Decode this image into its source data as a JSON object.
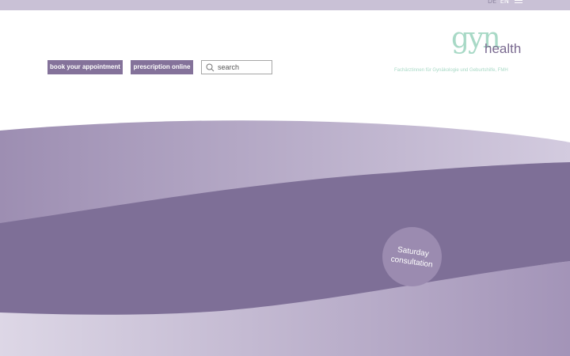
{
  "header": {
    "languages": [
      {
        "label": "DE",
        "active": false
      },
      {
        "label": "EN",
        "active": true
      }
    ],
    "menu_icon": "hamburger-menu-icon"
  },
  "actions": {
    "book_label": "book your appointment",
    "prescription_label": "prescription online"
  },
  "search": {
    "placeholder": "search",
    "value": "",
    "icon": "search-icon"
  },
  "logo": {
    "word1": "gyn",
    "word2": "health",
    "tagline": "Fachärztinnen für Gynäkologie und Geburtshilfe, FMH"
  },
  "hero": {
    "badge_text": "Saturday consultation"
  },
  "colors": {
    "brand_purple": "#84729a",
    "band_dark": "#7e6f97",
    "logo_mint": "#a8d9c6",
    "topbar": "#c9c1d6"
  }
}
